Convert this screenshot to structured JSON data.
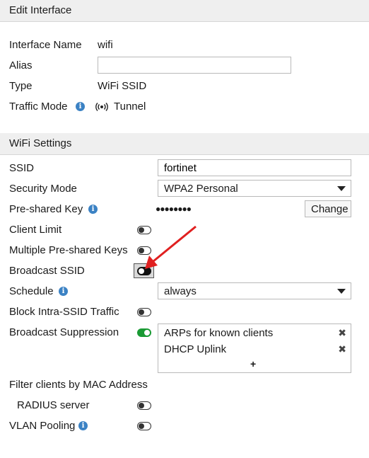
{
  "edit_interface": {
    "title": "Edit Interface",
    "interface_name_label": "Interface Name",
    "interface_name_value": "wifi",
    "alias_label": "Alias",
    "alias_value": "",
    "type_label": "Type",
    "type_value": "WiFi SSID",
    "traffic_mode_label": "Traffic Mode",
    "traffic_mode_value": "Tunnel",
    "traffic_mode_icon": "broadcast-icon"
  },
  "wifi_settings": {
    "title": "WiFi Settings",
    "ssid_label": "SSID",
    "ssid_value": "fortinet",
    "security_mode_label": "Security Mode",
    "security_mode_value": "WPA2 Personal",
    "psk_label": "Pre-shared Key",
    "psk_masked": "●●●●●●●●",
    "change_button": "Change",
    "client_limit_label": "Client Limit",
    "client_limit_on": false,
    "multiple_psk_label": "Multiple Pre-shared Keys",
    "multiple_psk_on": false,
    "broadcast_ssid_label": "Broadcast SSID",
    "broadcast_ssid_on": false,
    "schedule_label": "Schedule",
    "schedule_value": "always",
    "block_intra_label": "Block Intra-SSID Traffic",
    "block_intra_on": false,
    "broadcast_suppression_label": "Broadcast Suppression",
    "broadcast_suppression_on": true,
    "suppression_items": [
      "ARPs for known clients",
      "DHCP Uplink"
    ],
    "add_symbol": "+",
    "filter_mac_label": "Filter clients by MAC Address",
    "radius_label": "RADIUS server",
    "radius_on": false,
    "vlan_pooling_label": "VLAN Pooling",
    "vlan_pooling_on": false
  },
  "colors": {
    "toggle_on": "#1a9a34",
    "info_icon": "#3b82c4",
    "arrow": "#e02020"
  }
}
